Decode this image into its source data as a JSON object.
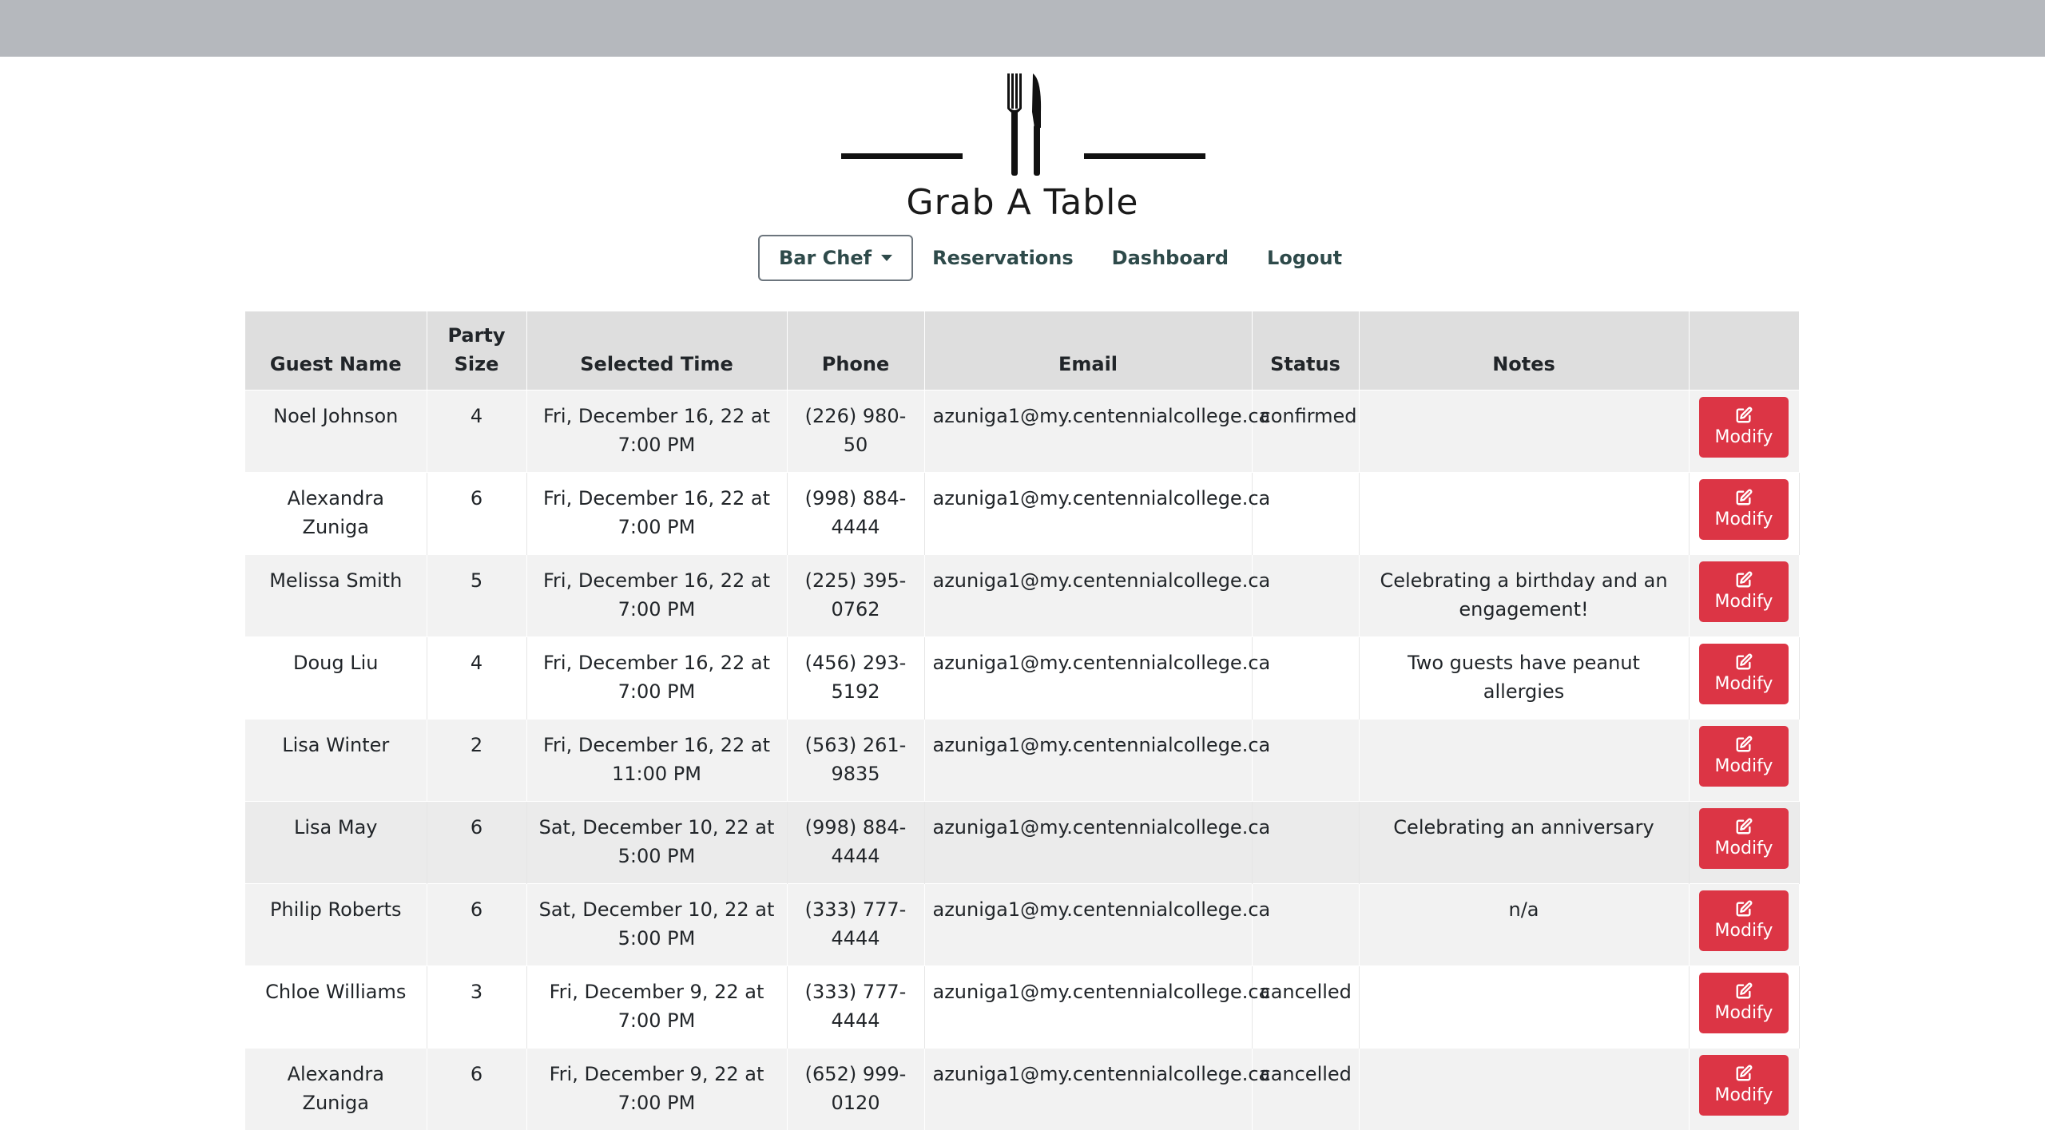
{
  "brand": {
    "name": "Grab A Table",
    "logo_icon": "fork-knife-icon"
  },
  "nav": {
    "dropdown_label": "Bar Chef",
    "links": [
      "Reservations",
      "Dashboard",
      "Logout"
    ]
  },
  "table": {
    "headers": {
      "guest_name": "Guest Name",
      "party_size": "Party Size",
      "selected_time": "Selected Time",
      "phone": "Phone",
      "email": "Email",
      "status": "Status",
      "notes": "Notes",
      "action": ""
    },
    "modify_label": "Modify",
    "modify_icon": "edit-icon",
    "rows": [
      {
        "guest": "Noel Johnson",
        "party": "4",
        "time": "Fri, December 16, 22 at 7:00 PM",
        "phone": "(226) 980-50",
        "email": "azuniga1@my.centennialcollege.ca",
        "status": "confirmed",
        "notes": ""
      },
      {
        "guest": "Alexandra Zuniga",
        "party": "6",
        "time": "Fri, December 16, 22 at 7:00 PM",
        "phone": "(998) 884-4444",
        "email": "azuniga1@my.centennialcollege.ca",
        "status": "",
        "notes": ""
      },
      {
        "guest": "Melissa Smith",
        "party": "5",
        "time": "Fri, December 16, 22 at 7:00 PM",
        "phone": "(225) 395-0762",
        "email": "azuniga1@my.centennialcollege.ca",
        "status": "",
        "notes": "Celebrating a birthday and an engagement!"
      },
      {
        "guest": "Doug Liu",
        "party": "4",
        "time": "Fri, December 16, 22 at 7:00 PM",
        "phone": "(456) 293-5192",
        "email": "azuniga1@my.centennialcollege.ca",
        "status": "",
        "notes": "Two guests have peanut allergies"
      },
      {
        "guest": "Lisa Winter",
        "party": "2",
        "time": "Fri, December 16, 22 at 11:00 PM",
        "phone": "(563) 261-9835",
        "email": "azuniga1@my.centennialcollege.ca",
        "status": "",
        "notes": ""
      },
      {
        "guest": "Lisa May",
        "party": "6",
        "time": "Sat, December 10, 22 at 5:00 PM",
        "phone": "(998) 884-4444",
        "email": "azuniga1@my.centennialcollege.ca",
        "status": "",
        "notes": "Celebrating an anniversary"
      },
      {
        "guest": "Philip Roberts",
        "party": "6",
        "time": "Sat, December 10, 22 at 5:00 PM",
        "phone": "(333) 777-4444",
        "email": "azuniga1@my.centennialcollege.ca",
        "status": "",
        "notes": "n/a"
      },
      {
        "guest": "Chloe Williams",
        "party": "3",
        "time": "Fri, December 9, 22 at 7:00 PM",
        "phone": "(333) 777-4444",
        "email": "azuniga1@my.centennialcollege.ca",
        "status": "cancelled",
        "notes": ""
      },
      {
        "guest": "Alexandra Zuniga",
        "party": "6",
        "time": "Fri, December 9, 22 at 7:00 PM",
        "phone": "(652) 999-0120",
        "email": "azuniga1@my.centennialcollege.ca",
        "status": "cancelled",
        "notes": ""
      }
    ]
  },
  "colors": {
    "topbar": "#b5b8bd",
    "nav_text": "#2e4a4a",
    "header_bg": "#dedede",
    "button_danger": "#dc3545"
  }
}
